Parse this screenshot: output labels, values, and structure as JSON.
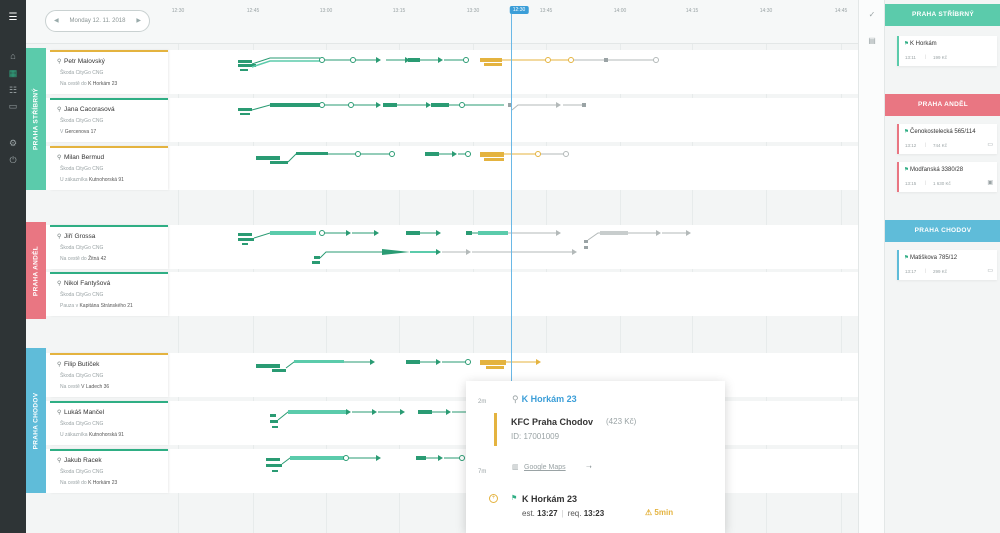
{
  "header": {
    "date": "Monday 12. 11. 2018",
    "ticks": [
      "12:30",
      "12:45",
      "13:00",
      "13:15",
      "13:30",
      "13:45",
      "14:00",
      "14:15",
      "14:30",
      "14:45"
    ],
    "now": "12:30"
  },
  "regions": [
    {
      "name": "PRAHA STŘÍBRNÝ",
      "color": "#5bcbab"
    },
    {
      "name": "PRAHA ANDĚL",
      "color": "#e97682"
    },
    {
      "name": "PRAHA CHODOV",
      "color": "#5fbcd9"
    }
  ],
  "drivers": [
    {
      "name": "Petr Malovský",
      "car": "Škoda CityGo CNG",
      "status_prefix": "Na cestě do",
      "status_place": "K Horkám 23",
      "accent": "gold"
    },
    {
      "name": "Jana Cacorasová",
      "car": "Škoda CityGo CNG",
      "status_prefix": "V",
      "status_place": "Gercenova 17",
      "accent": "green"
    },
    {
      "name": "Milan Bermud",
      "car": "Škoda CityGo CNG",
      "status_prefix": "U zákazníka",
      "status_place": "Kutnohorská 91",
      "accent": "gold"
    },
    {
      "name": "Jiří Grossa",
      "car": "Škoda CityGo CNG",
      "status_prefix": "Na cestě do",
      "status_place": "Žitná 42",
      "accent": "green"
    },
    {
      "name": "Nikol Fantyšová",
      "car": "Škoda CityGo CNG",
      "status_prefix": "Pauza v",
      "status_place": "Kapitána Stránského 21",
      "accent": "green"
    },
    {
      "name": "Filip Butíček",
      "car": "Škoda CityGo CNG",
      "status_prefix": "Na cestě",
      "status_place": "V Ladech 36",
      "accent": "gold"
    },
    {
      "name": "Lukáš Mančel",
      "car": "Škoda CityGo CNG",
      "status_prefix": "U zákazníka",
      "status_place": "Kutnohorská 91",
      "accent": "green"
    },
    {
      "name": "Jakub Racek",
      "car": "Škoda CityGo CNG",
      "status_prefix": "Na cestě do",
      "status_place": "K Horkám 23",
      "accent": "green"
    }
  ],
  "right_panel": [
    {
      "region": "PRAHA STŘÍBRNÝ",
      "color": "#5bcbab",
      "orders": [
        {
          "address": "K Horkám",
          "time": "13:11",
          "price": "199 Kč",
          "pay": ""
        }
      ]
    },
    {
      "region": "PRAHA ANDĚL",
      "color": "#e97682",
      "orders": [
        {
          "address": "Čenokostelecká 565/114",
          "time": "13:12",
          "price": "744 Kč",
          "pay": "card"
        },
        {
          "address": "Modřanská 3380/28",
          "time": "13:15",
          "price": "1 630 Kč",
          "pay": "cash"
        }
      ]
    },
    {
      "region": "PRAHA CHODOV",
      "color": "#5fbcd9",
      "orders": [
        {
          "address": "Matiškova 785/12",
          "time": "13:17",
          "price": "299 Kč",
          "pay": "card"
        }
      ]
    }
  ],
  "popup": {
    "min_top": "2m",
    "title": "K Horkám 23",
    "restaurant": "KFC Praha Chodov",
    "price": "(423 Kč)",
    "id_label": "ID: 17001009",
    "maps": "Google Maps",
    "min_bottom": "7m",
    "destination": "K Horkám 23",
    "est_label": "est.",
    "est_value": "13:27",
    "req_label": "req.",
    "req_value": "13:23",
    "warning": "5min"
  },
  "colors": {
    "green": "#2a9b73",
    "gold": "#e4b33f",
    "grey": "#b3b9b9",
    "teal": "#5bcbab",
    "blue": "#3b9ed8"
  }
}
